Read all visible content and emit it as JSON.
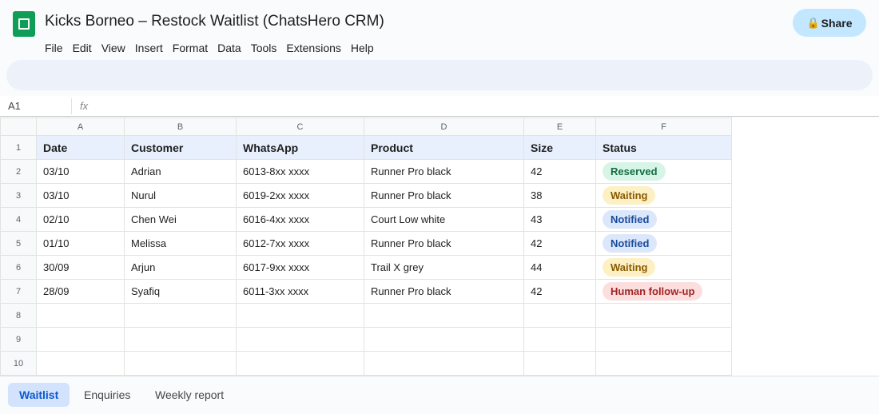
{
  "doc": {
    "title": "Kicks Borneo – Restock Waitlist (ChatsHero CRM)"
  },
  "menu": [
    "File",
    "Edit",
    "View",
    "Insert",
    "Format",
    "Data",
    "Tools",
    "Extensions",
    "Help"
  ],
  "share": {
    "icon": "🔒",
    "label": "Share"
  },
  "formula_bar": {
    "cell_ref": "A1",
    "fx": "fx",
    "value": ""
  },
  "columns": [
    "A",
    "B",
    "C",
    "D",
    "E",
    "F"
  ],
  "row_numbers": [
    "1",
    "2",
    "3",
    "4",
    "5",
    "6",
    "7",
    "8",
    "9",
    "10"
  ],
  "table": {
    "headers": [
      "Date",
      "Customer",
      "WhatsApp",
      "Product",
      "Size",
      "Status"
    ],
    "rows": [
      [
        "03/10",
        "Adrian",
        "6013-8xx xxxx",
        "Runner Pro black",
        "42",
        "Reserved"
      ],
      [
        "03/10",
        "Nurul",
        "6019-2xx xxxx",
        "Runner Pro black",
        "38",
        "Waiting"
      ],
      [
        "02/10",
        "Chen Wei",
        "6016-4xx xxxx",
        "Court Low white",
        "43",
        "Notified"
      ],
      [
        "01/10",
        "Melissa",
        "6012-7xx xxxx",
        "Runner Pro black",
        "42",
        "Notified"
      ],
      [
        "30/09",
        "Arjun",
        "6017-9xx xxxx",
        "Trail X grey",
        "44",
        "Waiting"
      ],
      [
        "28/09",
        "Syafiq",
        "6011-3xx xxxx",
        "Runner Pro black",
        "42",
        "Human follow-up"
      ]
    ]
  },
  "status_colors": {
    "Reserved": {
      "bg": "#d7f5e6",
      "fg": "#146c43"
    },
    "Waiting": {
      "bg": "#fdf0c4",
      "fg": "#8a5a00"
    },
    "Notified": {
      "bg": "#dbe7fb",
      "fg": "#1a4a9c"
    },
    "Human follow-up": {
      "bg": "#fcdede",
      "fg": "#a12626"
    }
  },
  "sheet_tabs": [
    {
      "label": "Waitlist",
      "active": true
    },
    {
      "label": "Enquiries",
      "active": false
    },
    {
      "label": "Weekly report",
      "active": false
    }
  ],
  "colors": {
    "logo": "#0f9d58",
    "share_bg": "#c2e7ff",
    "active_tab_bg": "#d3e3fd",
    "active_tab_fg": "#0b57d0"
  }
}
